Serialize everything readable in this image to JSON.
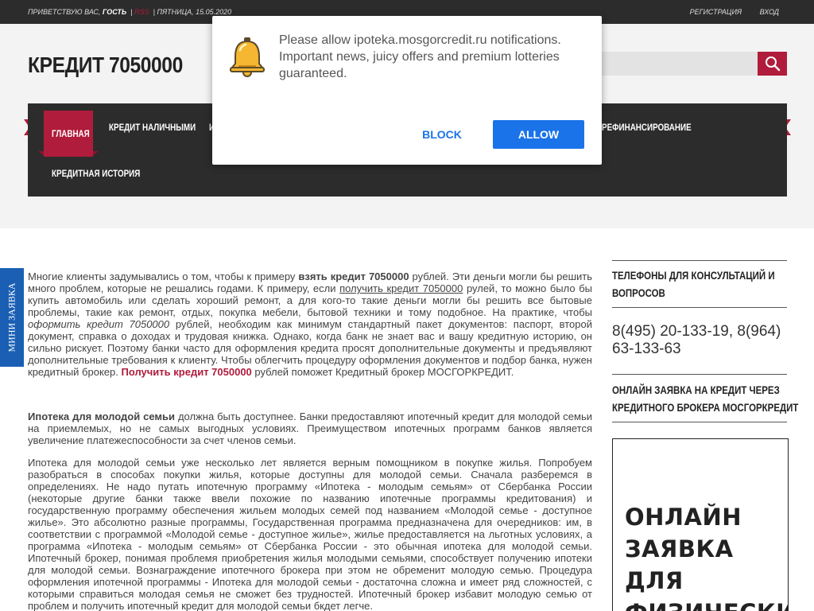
{
  "topbar": {
    "greeting": "Приветствую Вас,",
    "user": "Гость",
    "rss": "RSS",
    "date": "Пятница, 15.05.2020",
    "register": "Регистрация",
    "login": "Вход"
  },
  "header": {
    "logo": "КРЕДИТ 7050000",
    "search_placeholder": ""
  },
  "nav": {
    "items": [
      "Главная",
      "Кредит наличными",
      "И",
      "Рефинансирование",
      "Кредитная история"
    ],
    "active": "Главная"
  },
  "side_tab": {
    "label": "Мини заявка"
  },
  "article": {
    "p1_a": "Многие клиенты задумывались о том, чтобы к примеру ",
    "p1_b": "взять кредит 7050000",
    "p1_c": " рублей. Эти деньги могли бы решить много проблем, которые не решались годами. К примеру, если ",
    "p1_link": "получить кредит 7050000",
    "p1_d": " рулей, то можно было бы купить автомобиль или сделать хороший ремонт, а для кого-то такие деньги могли бы решить все бытовые проблемы, такие как ремонт, отдых, покупка мебели, бытовой техники и тому подобное. На практике, чтобы ",
    "p1_e": "оформить кредит 7050000",
    "p1_f": " рублей, необходим как минимум стандартный пакет документов: паспорт, второй документ, справка о доходах и трудовая книжка. Однако, когда банк не знает вас и вашу кредитную историю, он сильно рискует. Поэтому банки часто для оформления кредита просят дополнительные документы и предъявляют дополнительные требования к клиенту. Чтобы облегчить процедуру оформления документов и подбор банка, нужен кредитный брокер. ",
    "p1_red": "Получить кредит 7050000",
    "p1_g": " рублей поможет Кредитный брокер МОСГОРКРЕДИТ.",
    "p2_b": "Ипотека для молодой семьи",
    "p2_rest": " должна быть доступнее. Банки предоставляют ипотечный кредит для молодой семьи на приемлемых, но не самых выгодных условиях. Преимуществом ипотечных программ банков является увеличение платежеспособности за счет членов семьи.",
    "p3": "Ипотека для молодой семьи уже несколько лет является верным помощником в покупке жилья. Попробуем разобраться в способах покупки жилья, которые доступны для молодой семьи. Сначала разберемся в определениях. Не надо путать ипотечную программу «Ипотека - молодым семьям» от Сбербанка России (некоторые другие банки также ввели похожие по названию ипотечные программы кредитования) и государственную программу обеспечения жильем молодых семей под названием «Молодой семье - доступное жилье». Это абсолютно разные программы, Государственная программа предназначена для очередников: им, в соответствии с программой «Молодой семье - доступное жилье», жилье предоставляется на льготных условиях, а программа «Ипотека - молодым семьям» от Сбербанка России - это обычная ипотека для молодой семьи. Ипотечный брокер, понимая проблемя приобретения жилья молодыми семьями, способствует получению ипотеки для молодой семьи. Вознаграждение ипотечного брокера при этом не обременит молодую семью. Процедура оформления ипотечной программы - Ипотека для молодой семьи - достаточна сложна и имеет ряд сложностей, с которыми справиться молодая семья не сможет без трудностей. Ипотечный брокер избавит молодую семью от проблем и получить ипотечный кредит для молодой семьи бкдет легче."
  },
  "sidebar": {
    "heading1_l1": "Телефоны для консультаций и",
    "heading1_l2": "вопросов",
    "phones_l1": "8(495) 20-133-19, 8(964)",
    "phones_l2": "63-133-63",
    "heading2_l1": "Онлайн заявка на кредит через",
    "heading2_l2": "кредитного брокера Мосгоркредит",
    "banner_l1": "онлайн",
    "banner_l2": "заявка",
    "banner_l3": "для",
    "banner_l4": "физических"
  },
  "popup": {
    "message": "Please allow ipoteka.mosgorcredit.ru notifications. Important news, juicy offers and premium lotteries guaranteed.",
    "block": "BLOCK",
    "allow": "ALLOW"
  },
  "colors": {
    "accent": "#b01c3c",
    "dark": "#2c2c2c",
    "side_tab": "#1a5fb4",
    "popup_button": "#1a73e8"
  }
}
